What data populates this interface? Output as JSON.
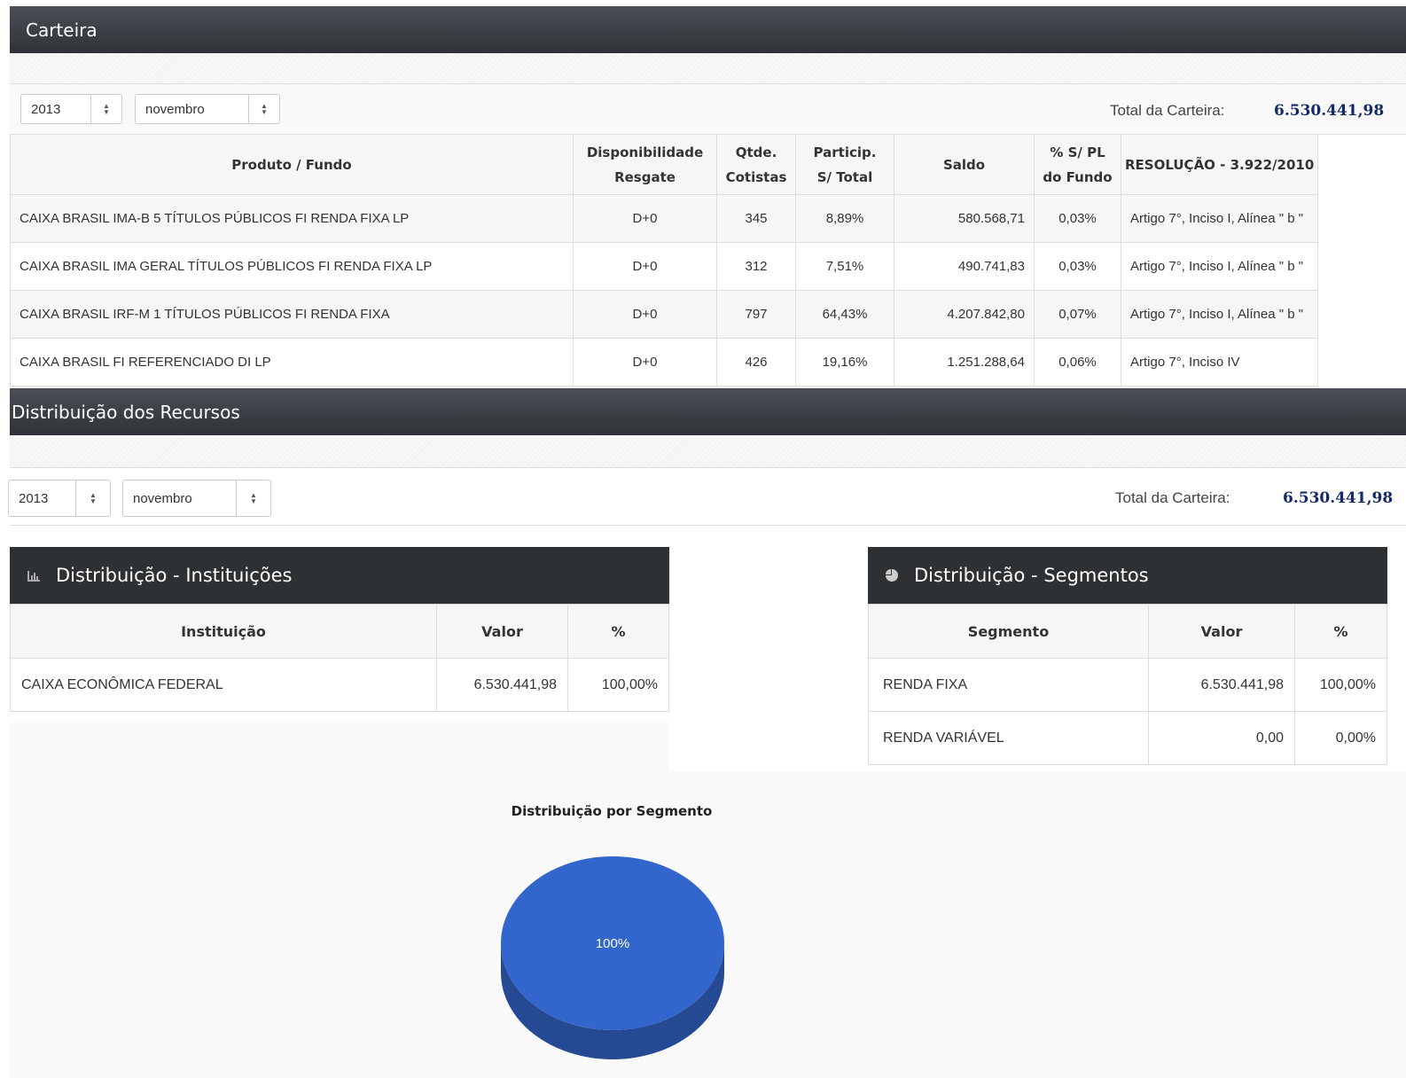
{
  "carteira": {
    "title": "Carteira",
    "year": "2013",
    "month": "novembro",
    "total_label": "Total da Carteira:",
    "total_value": "6.530.441,98",
    "headers": {
      "produto": "Produto / Fundo",
      "disp1": "Disponibilidade",
      "disp2": "Resgate",
      "qtde1": "Qtde.",
      "qtde2": "Cotistas",
      "part1": "Particip.",
      "part2": "S/ Total",
      "saldo": "Saldo",
      "pl1": "% S/ PL",
      "pl2": "do Fundo",
      "resolucao": "RESOLUÇÃO - 3.922/2010"
    },
    "rows": [
      {
        "produto": "CAIXA BRASIL IMA-B 5 TÍTULOS PÚBLICOS FI RENDA FIXA LP",
        "disp": "D+0",
        "qtde": "345",
        "part": "8,89%",
        "saldo": "580.568,71",
        "pl": "0,03%",
        "resolucao": "Artigo 7°, Inciso I, Alínea \" b \""
      },
      {
        "produto": "CAIXA BRASIL IMA GERAL TÍTULOS PÚBLICOS FI RENDA FIXA LP",
        "disp": "D+0",
        "qtde": "312",
        "part": "7,51%",
        "saldo": "490.741,83",
        "pl": "0,03%",
        "resolucao": "Artigo 7°, Inciso I, Alínea \" b \""
      },
      {
        "produto": "CAIXA BRASIL IRF-M 1 TÍTULOS PÚBLICOS FI RENDA FIXA",
        "disp": "D+0",
        "qtde": "797",
        "part": "64,43%",
        "saldo": "4.207.842,80",
        "pl": "0,07%",
        "resolucao": "Artigo 7°, Inciso I, Alínea \" b \""
      },
      {
        "produto": "CAIXA BRASIL FI REFERENCIADO DI LP",
        "disp": "D+0",
        "qtde": "426",
        "part": "19,16%",
        "saldo": "1.251.288,64",
        "pl": "0,06%",
        "resolucao": "Artigo 7°, Inciso IV"
      }
    ]
  },
  "distribuicao": {
    "title": "Distribuição dos Recursos",
    "year": "2013",
    "month": "novembro",
    "total_label": "Total da Carteira:",
    "total_value": "6.530.441,98"
  },
  "instituicoes": {
    "title": "Distribuição - Instituições",
    "icon": "bar-chart-icon",
    "headers": {
      "name": "Instituição",
      "valor": "Valor",
      "pct": "%"
    },
    "rows": [
      {
        "name": "CAIXA ECONÔMICA FEDERAL",
        "valor": "6.530.441,98",
        "pct": "100,00%"
      }
    ]
  },
  "segmentos": {
    "title": "Distribuição - Segmentos",
    "icon": "pie-chart-icon",
    "headers": {
      "name": "Segmento",
      "valor": "Valor",
      "pct": "%"
    },
    "rows": [
      {
        "name": "RENDA FIXA",
        "valor": "6.530.441,98",
        "pct": "100,00%"
      },
      {
        "name": "RENDA VARIÁVEL",
        "valor": "0,00",
        "pct": "0,00%"
      }
    ]
  },
  "chart_data": {
    "type": "pie",
    "title": "Distribuição por Segmento",
    "slices": [
      {
        "label": "RENDA FIXA",
        "value": 100,
        "display": "100%",
        "color": "#3366cc"
      }
    ]
  }
}
